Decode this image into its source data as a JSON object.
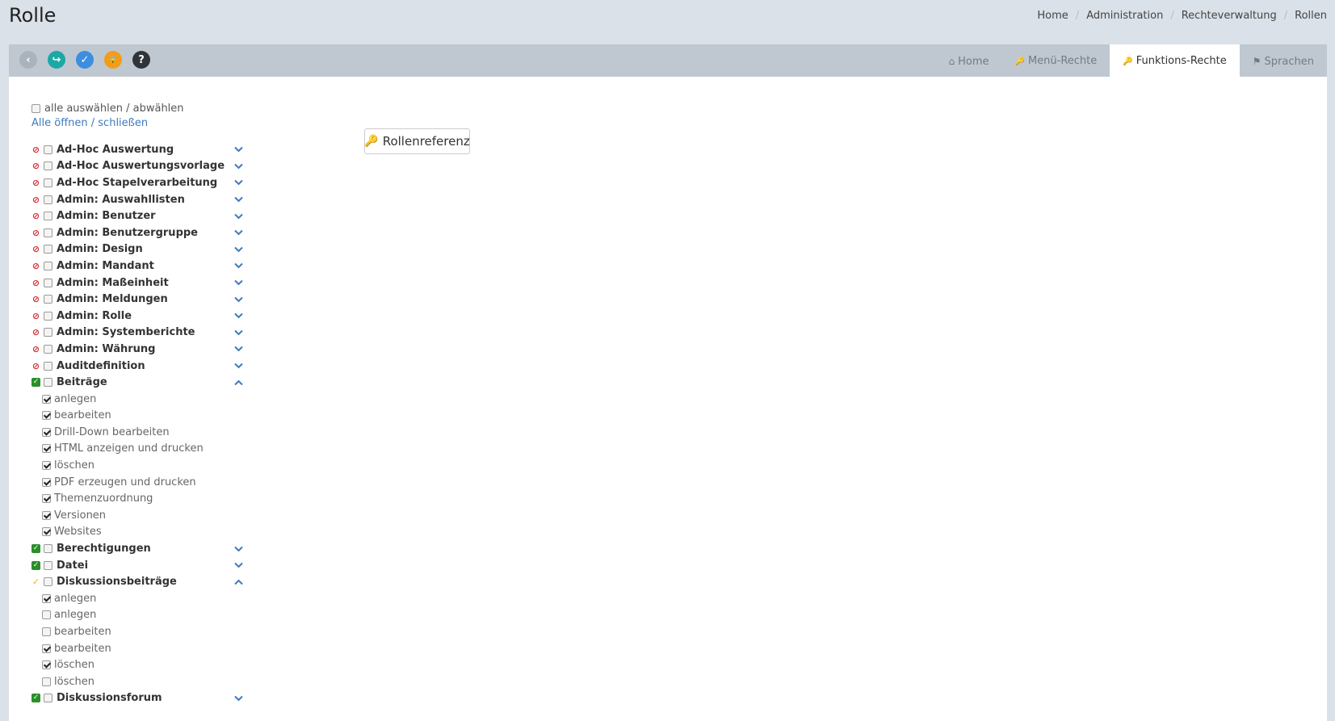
{
  "page": {
    "title": "Rolle"
  },
  "breadcrumb": [
    "Home",
    "Administration",
    "Rechteverwaltung",
    "Rollen"
  ],
  "toolbar": {
    "buttons": [
      {
        "name": "back",
        "glyph": "‹",
        "color": "#a9b3bc"
      },
      {
        "name": "reset",
        "glyph": "↪",
        "color": "#1aa9a4"
      },
      {
        "name": "save",
        "glyph": "✓",
        "color": "#3c8ee0"
      },
      {
        "name": "lock",
        "glyph": "🔒",
        "color": "#f39c1a"
      },
      {
        "name": "help",
        "glyph": "?",
        "color": "#2f3438"
      }
    ]
  },
  "tabs": [
    {
      "label": "Home",
      "icon": "home-icon",
      "glyph": "⌂"
    },
    {
      "label": "Menü-Rechte",
      "icon": "key-icon",
      "glyph": "🔑"
    },
    {
      "label": "Funktions-Rechte",
      "icon": "key-icon",
      "glyph": "🔑"
    },
    {
      "label": "Sprachen",
      "icon": "flag-icon",
      "glyph": "⚑"
    }
  ],
  "select_all_label": "alle auswählen / abwählen",
  "toggle_all_label": "Alle öffnen / schließen",
  "rollenreferenz_label": "Rollenreferenz",
  "tree": [
    {
      "label": "Ad-Hoc Auswertung",
      "status": "deny",
      "expanded": false
    },
    {
      "label": "Ad-Hoc Auswertungsvorlage",
      "status": "deny",
      "expanded": false
    },
    {
      "label": "Ad-Hoc Stapelverarbeitung",
      "status": "deny",
      "expanded": false
    },
    {
      "label": "Admin: Auswahllisten",
      "status": "deny",
      "expanded": false
    },
    {
      "label": "Admin: Benutzer",
      "status": "deny",
      "expanded": false
    },
    {
      "label": "Admin: Benutzergruppe",
      "status": "deny",
      "expanded": false
    },
    {
      "label": "Admin: Design",
      "status": "deny",
      "expanded": false
    },
    {
      "label": "Admin: Mandant",
      "status": "deny",
      "expanded": false
    },
    {
      "label": "Admin: Maßeinheit",
      "status": "deny",
      "expanded": false
    },
    {
      "label": "Admin: Meldungen",
      "status": "deny",
      "expanded": false
    },
    {
      "label": "Admin: Rolle",
      "status": "deny",
      "expanded": false
    },
    {
      "label": "Admin: Systemberichte",
      "status": "deny",
      "expanded": false
    },
    {
      "label": "Admin: Währung",
      "status": "deny",
      "expanded": false
    },
    {
      "label": "Auditdefinition",
      "status": "deny",
      "expanded": false
    },
    {
      "label": "Beiträge",
      "status": "ok",
      "expanded": true,
      "children": [
        {
          "label": "anlegen",
          "checked": true
        },
        {
          "label": "bearbeiten",
          "checked": true
        },
        {
          "label": "Drill-Down bearbeiten",
          "checked": true
        },
        {
          "label": "HTML anzeigen und drucken",
          "checked": true
        },
        {
          "label": "löschen",
          "checked": true
        },
        {
          "label": "PDF erzeugen und drucken",
          "checked": true
        },
        {
          "label": "Themenzuordnung",
          "checked": true
        },
        {
          "label": "Versionen",
          "checked": true
        },
        {
          "label": "Websites",
          "checked": true
        }
      ]
    },
    {
      "label": "Berechtigungen",
      "status": "ok",
      "expanded": false
    },
    {
      "label": "Datei",
      "status": "ok",
      "expanded": false
    },
    {
      "label": "Diskussionsbeiträge",
      "status": "partial",
      "expanded": true,
      "children": [
        {
          "label": "anlegen",
          "checked": true
        },
        {
          "label": "anlegen",
          "checked": false
        },
        {
          "label": "bearbeiten",
          "checked": false
        },
        {
          "label": "bearbeiten",
          "checked": true
        },
        {
          "label": "löschen",
          "checked": true
        },
        {
          "label": "löschen",
          "checked": false
        }
      ]
    },
    {
      "label": "Diskussionsforum",
      "status": "ok",
      "expanded": false
    }
  ]
}
